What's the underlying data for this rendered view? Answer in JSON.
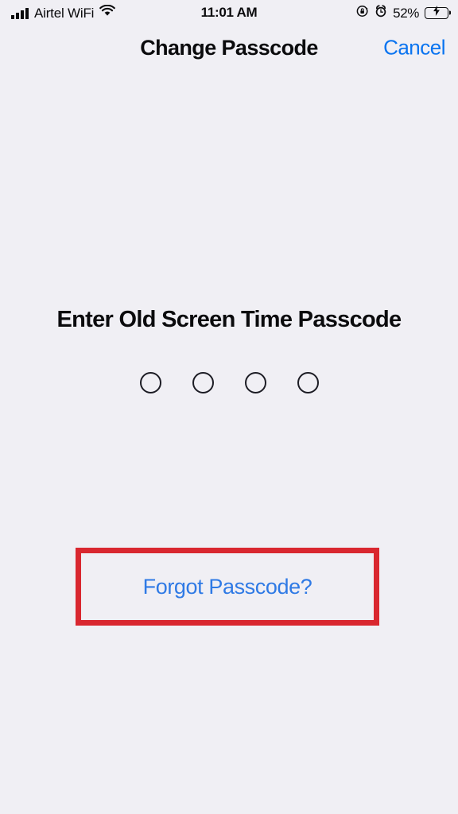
{
  "status_bar": {
    "carrier": "Airtel WiFi",
    "signal_icon": "signal-bars-icon",
    "wifi_icon": "wifi-icon",
    "time": "11:01 AM",
    "rotation_lock_icon": "rotation-lock-icon",
    "alarm_icon": "alarm-clock-icon",
    "battery_percent": "52%",
    "battery_level": 52,
    "battery_charging": true,
    "battery_color": "#33d158"
  },
  "nav_bar": {
    "title": "Change Passcode",
    "cancel_label": "Cancel",
    "accent_color": "#0a74f0"
  },
  "main": {
    "heading": "Enter Old Screen Time Passcode",
    "passcode_length": 4,
    "passcode_entered": 0,
    "forgot_label": "Forgot Passcode?",
    "link_color": "#2f7ae5"
  },
  "annotation": {
    "color": "#d9272f",
    "target": "Forgot Passcode?"
  },
  "theme": {
    "background": "#f0eff4",
    "text_color": "#0b0b0d"
  }
}
